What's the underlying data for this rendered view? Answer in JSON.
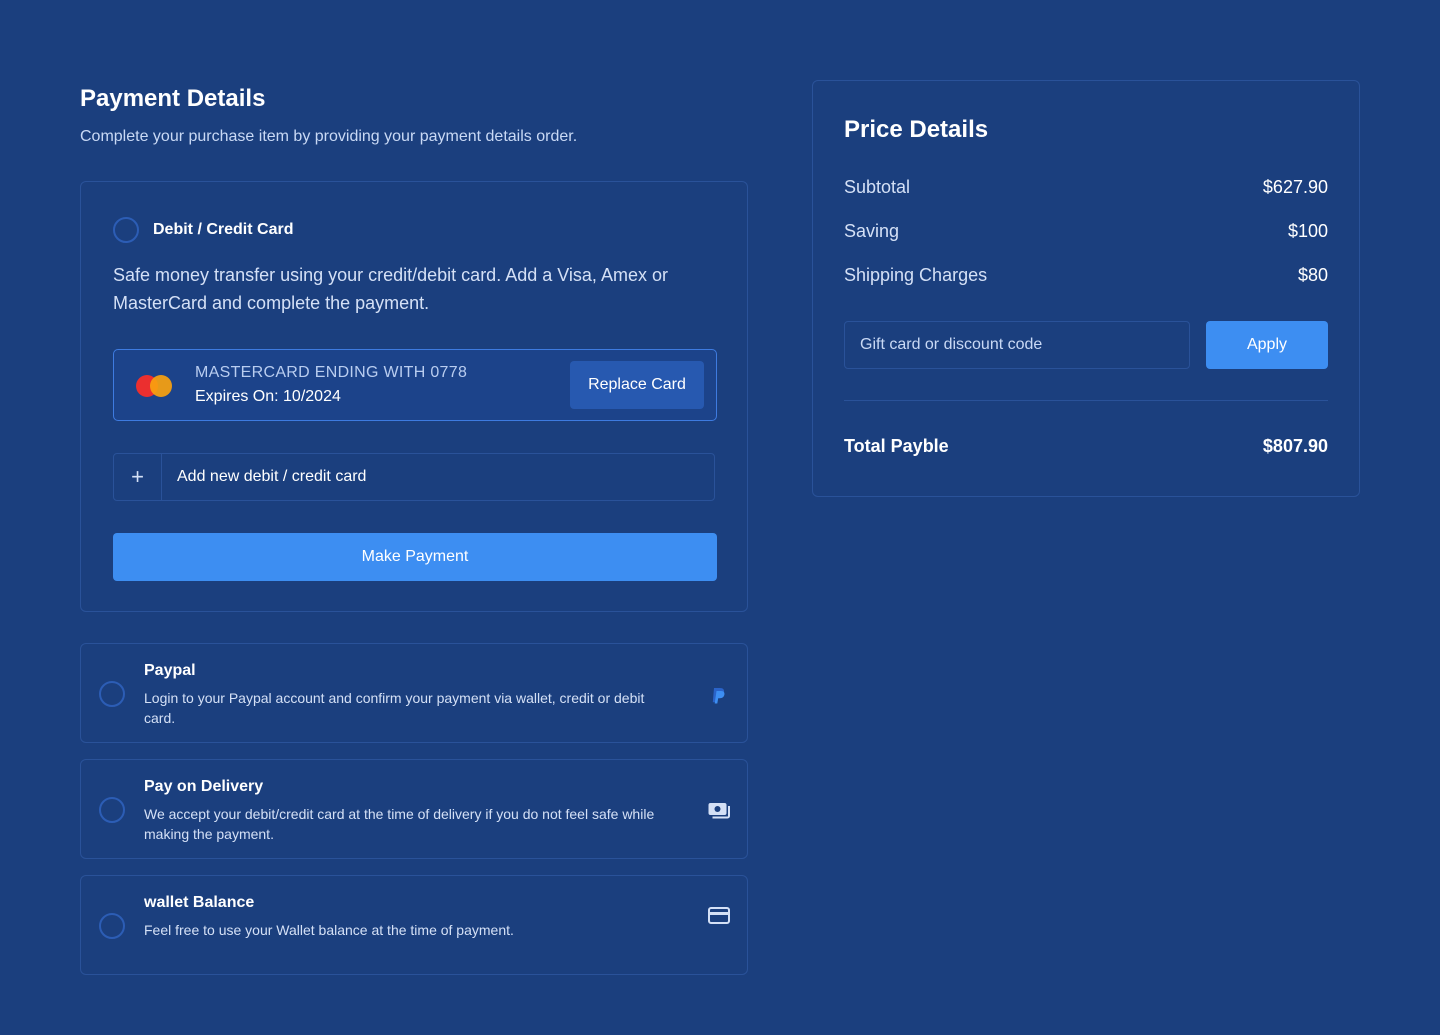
{
  "payment": {
    "title": "Payment Details",
    "subtitle": "Complete your purchase item by providing your payment details order."
  },
  "card_method": {
    "title": "Debit / Credit Card",
    "description": "Safe money transfer using your credit/debit card. Add a Visa, Amex or MasterCard and complete the payment.",
    "saved_card": {
      "name": "MASTERCARD ENDING WITH 0778",
      "expires": "Expires On: 10/2024",
      "replace_label": "Replace Card"
    },
    "add_plus": "+",
    "add_label": "Add new debit / credit card",
    "pay_label": "Make Payment"
  },
  "options": [
    {
      "title": "Paypal",
      "description": "Login to your Paypal account and confirm your payment via wallet, credit or debit card.",
      "icon": "paypal-icon"
    },
    {
      "title": "Pay on Delivery",
      "description": "We accept your debit/credit card at the time of delivery if you do not feel safe while making the payment.",
      "icon": "cash-icon"
    },
    {
      "title": "wallet Balance",
      "description": "Feel free to use your Wallet balance at the time of payment.",
      "icon": "card-icon"
    }
  ],
  "price": {
    "title": "Price Details",
    "rows": [
      {
        "label": "Subtotal",
        "value": "$627.90"
      },
      {
        "label": "Saving",
        "value": "$100"
      },
      {
        "label": "Shipping Charges",
        "value": "$80"
      }
    ],
    "discount_placeholder": "Gift card or discount code",
    "apply_label": "Apply",
    "total_label": "Total Payble",
    "total_value": "$807.90"
  },
  "colors": {
    "background": "#1b3f7e",
    "accent": "#3d8ef2",
    "border": "#2a5299"
  }
}
